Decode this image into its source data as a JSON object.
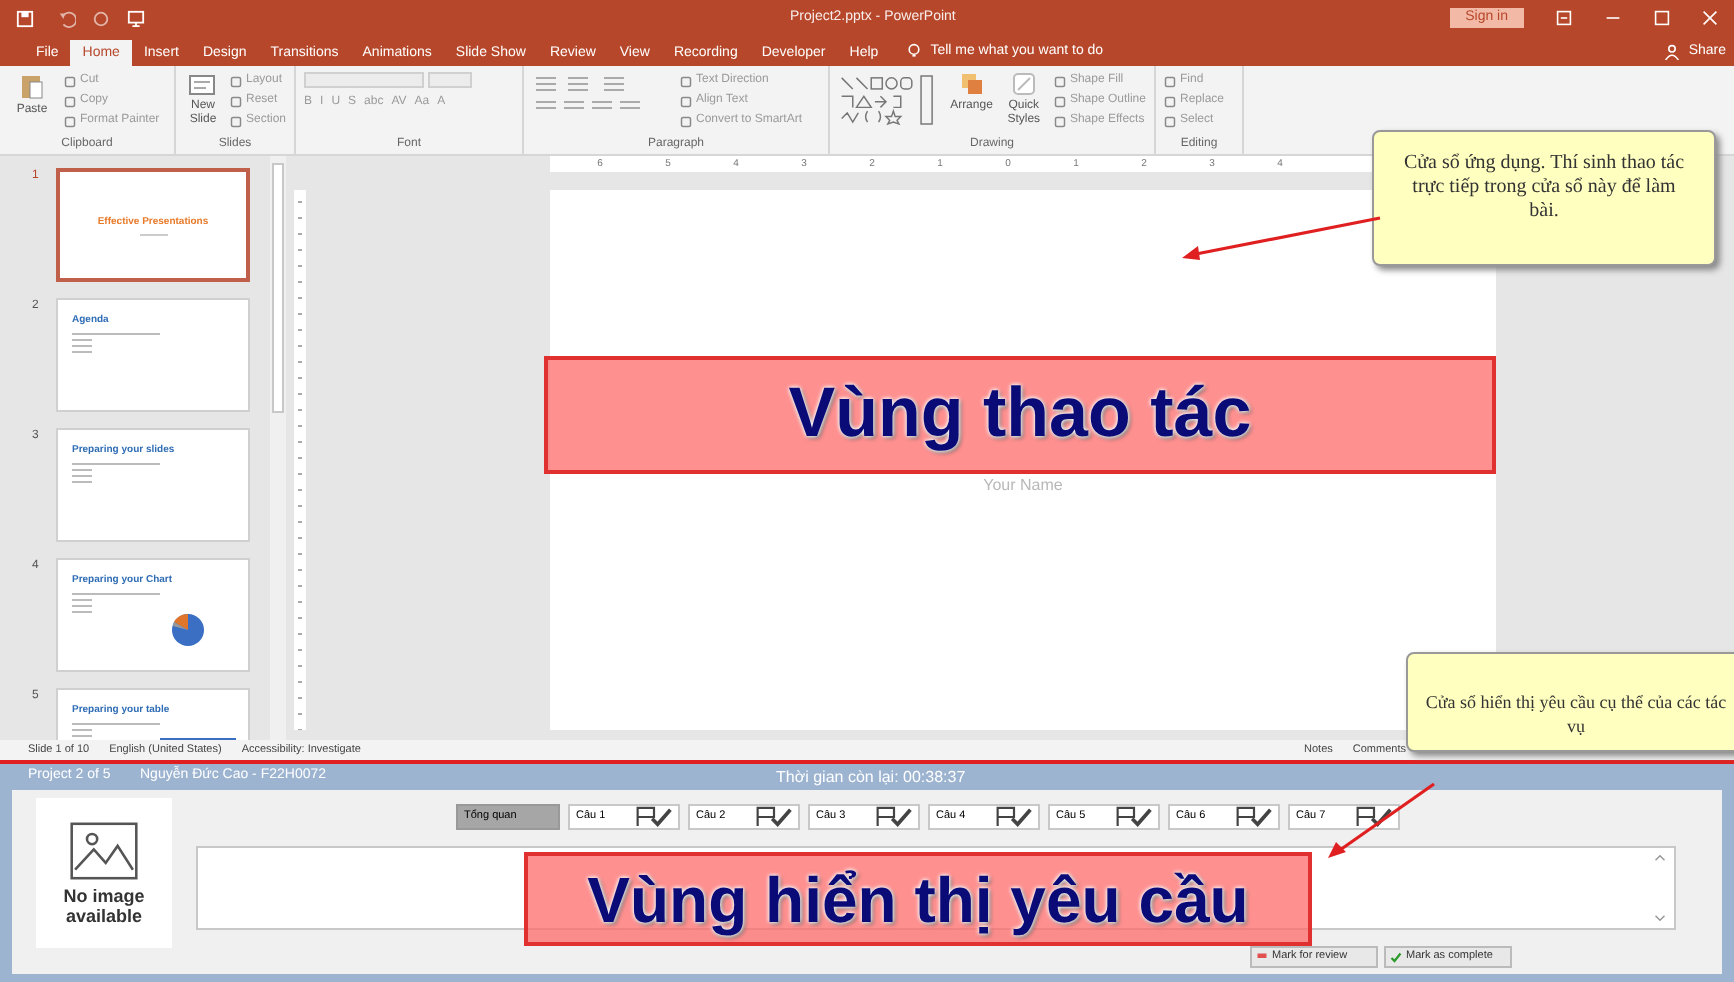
{
  "title_bar": {
    "title": "Project2.pptx - PowerPoint",
    "sign_in": "Sign in"
  },
  "ribbon_tabs": [
    {
      "label": "File",
      "selected": false
    },
    {
      "label": "Home",
      "selected": true
    },
    {
      "label": "Insert",
      "selected": false
    },
    {
      "label": "Design",
      "selected": false
    },
    {
      "label": "Transitions",
      "selected": false
    },
    {
      "label": "Animations",
      "selected": false
    },
    {
      "label": "Slide Show",
      "selected": false
    },
    {
      "label": "Review",
      "selected": false
    },
    {
      "label": "View",
      "selected": false
    },
    {
      "label": "Recording",
      "selected": false
    },
    {
      "label": "Developer",
      "selected": false
    },
    {
      "label": "Help",
      "selected": false
    }
  ],
  "tell_me": "Tell me what you want to do",
  "share": "Share",
  "ribbon_groups": [
    {
      "kind": "clipboard",
      "label": "Clipboard",
      "large": [
        "Paste"
      ],
      "small": [
        "Cut",
        "Copy",
        "Format Painter"
      ]
    },
    {
      "kind": "slides",
      "label": "Slides",
      "large": [
        "New Slide"
      ],
      "small": [
        "Layout",
        "Reset",
        "Section"
      ]
    },
    {
      "kind": "font",
      "label": "Font",
      "buttons": [
        "B",
        "I",
        "U",
        "S",
        "abc",
        "AV",
        "Aa",
        "A"
      ]
    },
    {
      "kind": "paragraph",
      "label": "Paragraph",
      "small": [
        "Text Direction",
        "Align Text",
        "Convert to SmartArt"
      ]
    },
    {
      "kind": "drawing",
      "label": "Drawing",
      "large": [
        "Arrange",
        "Quick Styles"
      ],
      "small": [
        "Shape Fill",
        "Shape Outline",
        "Shape Effects"
      ]
    },
    {
      "kind": "editing",
      "label": "Editing",
      "small": [
        "Find",
        "Replace",
        "Select"
      ]
    }
  ],
  "thumbnails": [
    {
      "number": "1",
      "title": "Effective Presentations",
      "kind": "title",
      "selected": true
    },
    {
      "number": "2",
      "title": "Agenda",
      "kind": "bullets",
      "selected": false
    },
    {
      "number": "3",
      "title": "Preparing your slides",
      "kind": "bullets",
      "selected": false
    },
    {
      "number": "4",
      "title": "Preparing your Chart",
      "kind": "chart",
      "selected": false
    },
    {
      "number": "5",
      "title": "Preparing your table",
      "kind": "table",
      "selected": false
    }
  ],
  "ruler": [
    "6",
    "5",
    "4",
    "3",
    "2",
    "1",
    "0",
    "1",
    "2",
    "3",
    "4"
  ],
  "slide": {
    "subtitle": "Your Name"
  },
  "status_bar": {
    "left": [
      "Slide 1 of 10",
      "English (United States)",
      "Accessibility: Investigate"
    ],
    "right": [
      "Notes",
      "Comments"
    ]
  },
  "exam_panel": {
    "project": "Project 2 of 5",
    "candidate": "Nguyễn Đức Cao - F22H0072",
    "timer": "Thời gian còn lại: 00:38:37",
    "no_image": "No image available",
    "tabs": [
      {
        "label": "Tổng quan",
        "kind": "overview",
        "selected": true
      },
      {
        "label": "Câu 1",
        "kind": "question",
        "selected": false
      },
      {
        "label": "Câu 2",
        "kind": "question",
        "selected": false
      },
      {
        "label": "Câu 3",
        "kind": "question",
        "selected": false
      },
      {
        "label": "Câu 4",
        "kind": "question",
        "selected": false
      },
      {
        "label": "Câu 5",
        "kind": "question",
        "selected": false
      },
      {
        "label": "Câu 6",
        "kind": "question",
        "selected": false
      },
      {
        "label": "Câu 7",
        "kind": "question",
        "selected": false
      }
    ],
    "buttons": [
      {
        "label": "Mark for review",
        "kind": "flag"
      },
      {
        "label": "Mark as complete",
        "kind": "check"
      }
    ]
  },
  "annotations": {
    "regions": [
      "Vùng thao tác",
      "Vùng hiển thị yêu cầu"
    ],
    "callouts": [
      "Cửa sổ ứng dụng. Thí sinh thao tác trực tiếp trong cửa sổ này để làm bài.",
      "Cửa sổ hiển thị yêu cầu cụ thể của các tác vụ"
    ]
  }
}
